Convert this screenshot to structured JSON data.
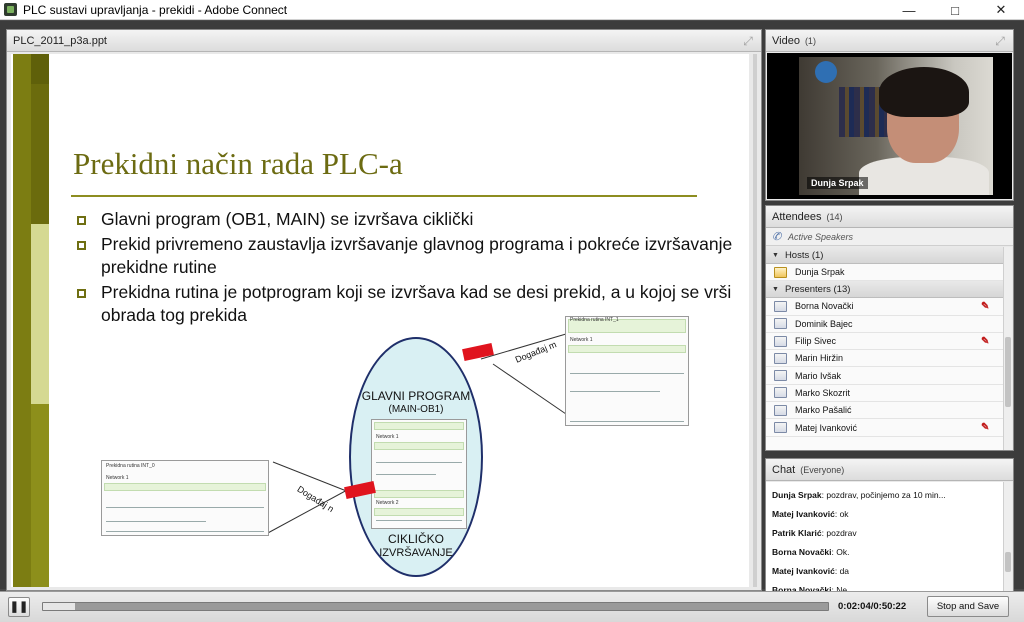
{
  "window": {
    "title": "PLC sustavi upravljanja - prekidi - Adobe Connect",
    "controls": [
      "—",
      "□",
      "✕"
    ]
  },
  "share_pod": {
    "title": "PLC_2011_p3a.ppt",
    "slide": {
      "heading": "Prekidni način rada PLC-a",
      "bullets": [
        "Glavni program (OB1, MAIN) se izvršava ciklički",
        "Prekid privremeno zaustavlja izvršavanje glavnog programa  i pokreće izvršavanje prekidne rutine",
        "Prekidna rutina je potprogram koji se izvršava kad se desi prekid, a u kojoj se vrši obrada tog prekida"
      ],
      "diagram": {
        "main_label": "GLAVNI PROGRAM",
        "main_sub": "(MAIN-OB1)",
        "cycle_label_1": "CIKLIČKO",
        "cycle_label_2": "IZVRŠAVANJE",
        "event_n": "Događaj n",
        "event_m": "Događaj m",
        "mini_left_title": "Prekidna rutina INT_0",
        "mini_left_net": "Network 1",
        "mini_right_title": "Prekidna rutina INT_1",
        "mini_right_net": "Network 1",
        "mini_center_net1": "Network 1",
        "mini_center_net2": "Network 2"
      }
    }
  },
  "video_pod": {
    "title": "Video",
    "count": "(1)",
    "name": "Dunja Srpak"
  },
  "attendees_pod": {
    "title": "Attendees",
    "count": "(14)",
    "active_speakers": "Active Speakers",
    "hosts_group": "Hosts (1)",
    "hosts": [
      "Dunja Srpak"
    ],
    "presenters_group": "Presenters (13)",
    "presenters": [
      {
        "name": "Borna Novački",
        "mic": true
      },
      {
        "name": "Dominik Bajec",
        "mic": false
      },
      {
        "name": "Filip Sivec",
        "mic": true
      },
      {
        "name": "Marin Hiržin",
        "mic": false
      },
      {
        "name": "Mario Ivšak",
        "mic": false
      },
      {
        "name": "Marko Skozrit",
        "mic": false
      },
      {
        "name": "Marko Pašalić",
        "mic": false
      },
      {
        "name": "Matej Ivanković",
        "mic": true
      }
    ]
  },
  "chat_pod": {
    "title": "Chat",
    "scope": "(Everyone)",
    "messages": [
      {
        "author": "Dunja Srpak",
        "text": "pozdrav, počinjemo za 10 min..."
      },
      {
        "author": "Matej Ivanković",
        "text": "ok"
      },
      {
        "author": "Patrik Klarić",
        "text": "pozdrav"
      },
      {
        "author": "Borna Novački",
        "text": "Ok."
      },
      {
        "author": "Matej Ivanković",
        "text": "da"
      },
      {
        "author": "Borna Novački",
        "text": "Ne"
      }
    ]
  },
  "playback": {
    "play_icon": "pause",
    "progress_fraction": 0.041,
    "time": "0:02:04/0:50:22",
    "stop_save_label": "Stop and Save"
  }
}
